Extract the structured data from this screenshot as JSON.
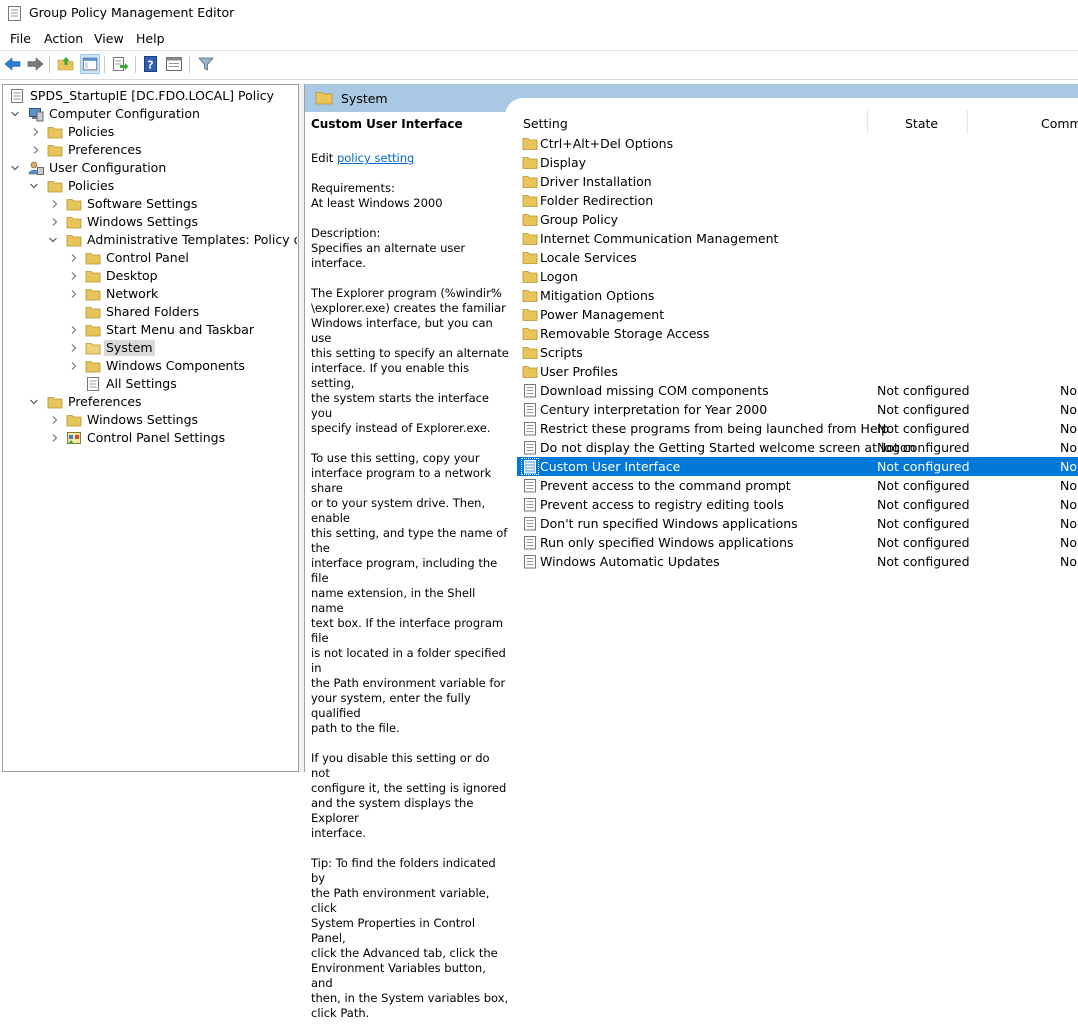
{
  "window": {
    "title": "Group Policy Management Editor"
  },
  "menu": {
    "items": [
      "File",
      "Action",
      "View",
      "Help"
    ]
  },
  "toolbar": {
    "buttons": [
      "back-icon",
      "forward-icon",
      "up-folder-icon",
      "show-hide-tree-icon",
      "export-list-icon",
      "help-icon",
      "properties-icon",
      "filter-icon"
    ],
    "pressed": "show-hide-tree-icon"
  },
  "tree": {
    "root": "SPDS_StartupIE [DC.FDO.LOCAL] Policy",
    "computer_config": "Computer Configuration",
    "cc_policies": "Policies",
    "cc_preferences": "Preferences",
    "user_config": "User Configuration",
    "uc_policies": "Policies",
    "software_settings": "Software Settings",
    "windows_settings": "Windows Settings",
    "admin_templates": "Administrative Templates: Policy definiti",
    "control_panel": "Control Panel",
    "desktop": "Desktop",
    "network": "Network",
    "shared_folders": "Shared Folders",
    "start_menu": "Start Menu and Taskbar",
    "system": "System",
    "windows_components": "Windows Components",
    "all_settings": "All Settings",
    "uc_preferences": "Preferences",
    "pref_windows_settings": "Windows Settings",
    "pref_control_panel": "Control Panel Settings"
  },
  "right": {
    "header_title": "System",
    "description": {
      "title": "Custom User Interface",
      "edit_prefix": "Edit ",
      "edit_link": "policy setting",
      "requirements": "Requirements:\nAt least Windows 2000",
      "desc": "Description:\nSpecifies an alternate user interface.",
      "p1": "The Explorer program (%windir%\n\\explorer.exe) creates the familiar\nWindows interface, but you can use\nthis setting to specify an alternate\ninterface. If you enable this setting,\nthe system starts the interface you\nspecify instead of Explorer.exe.",
      "p2": "To use this setting, copy your\ninterface program to a network share\nor to your system drive. Then, enable\nthis setting, and type the name of the\ninterface program, including the file\nname extension, in the Shell name\ntext box. If the interface program file\nis not located in a folder specified in\nthe Path environment variable for\nyour system, enter the fully qualified\npath to the file.",
      "p3": "If you disable this setting or do not\nconfigure it, the setting is ignored\nand the system displays the Explorer\ninterface.",
      "p4": "Tip: To find the folders indicated by\nthe Path environment variable, click\nSystem Properties in Control Panel,\nclick the Advanced tab, click the\nEnvironment Variables button, and\nthen, in the System variables box,\nclick Path."
    },
    "columns": {
      "setting": "Setting",
      "state": "State",
      "comment": "Comm"
    },
    "folders": [
      "Ctrl+Alt+Del Options",
      "Display",
      "Driver Installation",
      "Folder Redirection",
      "Group Policy",
      "Internet Communication Management",
      "Locale Services",
      "Logon",
      "Mitigation Options",
      "Power Management",
      "Removable Storage Access",
      "Scripts",
      "User Profiles"
    ],
    "settings": [
      {
        "name": "Download missing COM components",
        "state": "Not configured",
        "comment": "No"
      },
      {
        "name": "Century interpretation for Year 2000",
        "state": "Not configured",
        "comment": "No"
      },
      {
        "name": "Restrict these programs from being launched from Help",
        "state": "Not configured",
        "comment": "No"
      },
      {
        "name": "Do not display the Getting Started welcome screen at logon",
        "state": "Not configured",
        "comment": "No"
      },
      {
        "name": "Custom User Interface",
        "state": "Not configured",
        "comment": "No"
      },
      {
        "name": "Prevent access to the command prompt",
        "state": "Not configured",
        "comment": "No"
      },
      {
        "name": "Prevent access to registry editing tools",
        "state": "Not configured",
        "comment": "No"
      },
      {
        "name": "Don't run specified Windows applications",
        "state": "Not configured",
        "comment": "No"
      },
      {
        "name": "Run only specified Windows applications",
        "state": "Not configured",
        "comment": "No"
      },
      {
        "name": "Windows Automatic Updates",
        "state": "Not configured",
        "comment": "No"
      }
    ],
    "selected_setting": "Custom User Interface"
  },
  "colors": {
    "selection": "#0078d7",
    "header": "#a8c8e4",
    "folder": "#e8c55a",
    "link": "#0066cc"
  }
}
